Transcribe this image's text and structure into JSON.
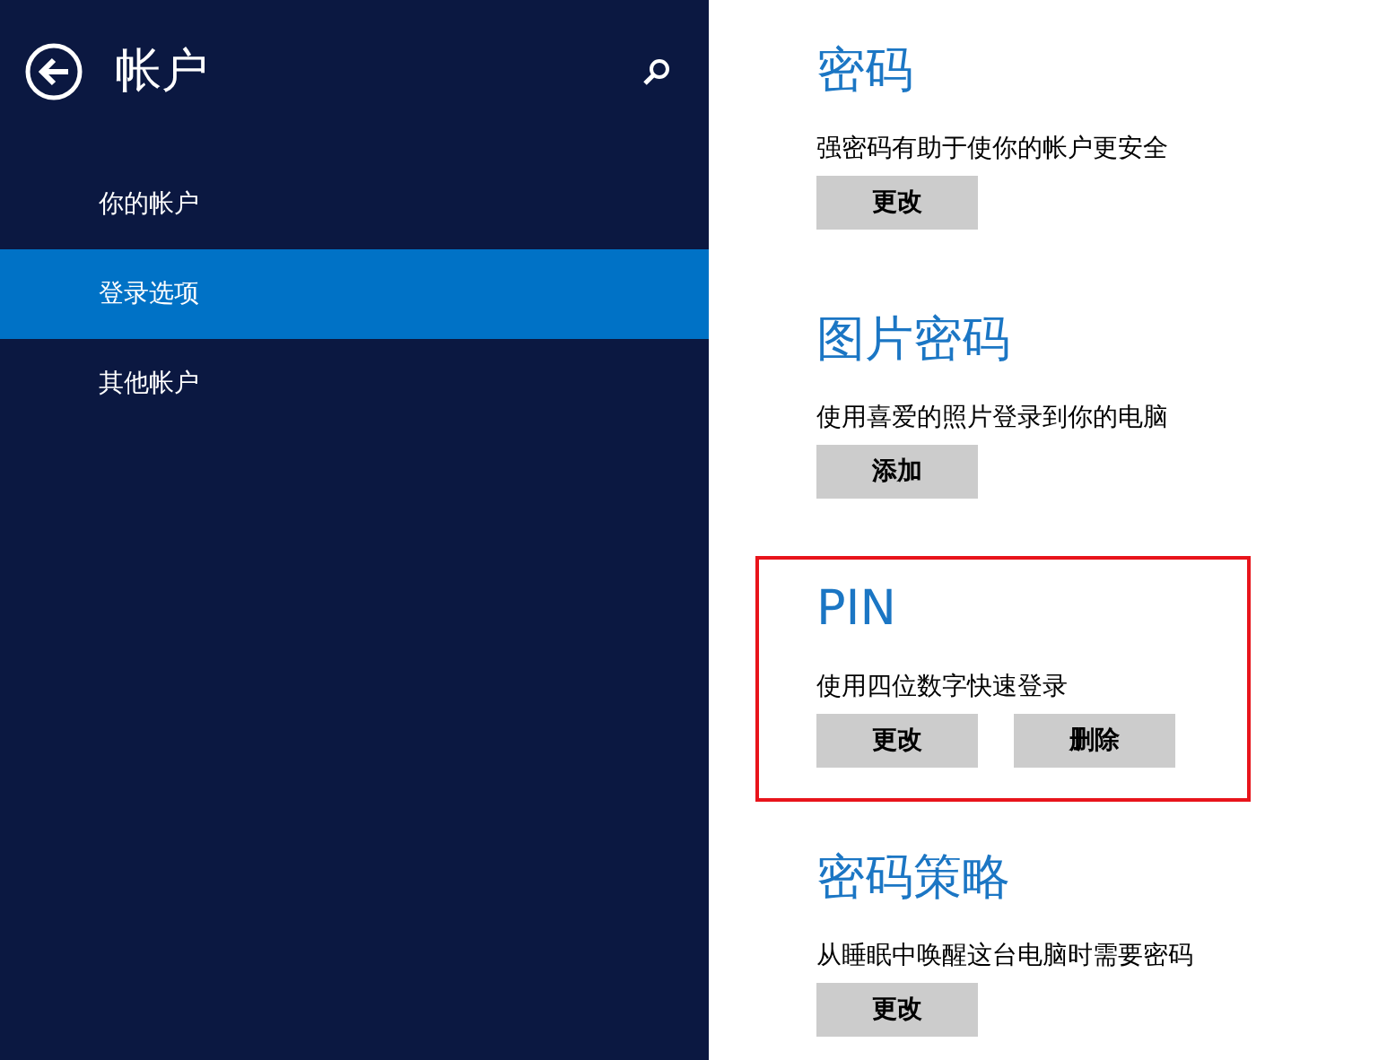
{
  "sidebar": {
    "title": "帐户",
    "items": [
      {
        "label": "你的帐户",
        "selected": false
      },
      {
        "label": "登录选项",
        "selected": true
      },
      {
        "label": "其他帐户",
        "selected": false
      }
    ]
  },
  "sections": [
    {
      "heading": "密码",
      "description": "强密码有助于使你的帐户更安全",
      "highlighted": false,
      "buttons": [
        "更改"
      ]
    },
    {
      "heading": "图片密码",
      "description": "使用喜爱的照片登录到你的电脑",
      "highlighted": false,
      "buttons": [
        "添加"
      ]
    },
    {
      "heading": "PIN",
      "description": "使用四位数字快速登录",
      "highlighted": true,
      "buttons": [
        "更改",
        "删除"
      ]
    },
    {
      "heading": "密码策略",
      "description": "从睡眠中唤醒这台电脑时需要密码",
      "highlighted": false,
      "buttons": [
        "更改"
      ]
    }
  ]
}
